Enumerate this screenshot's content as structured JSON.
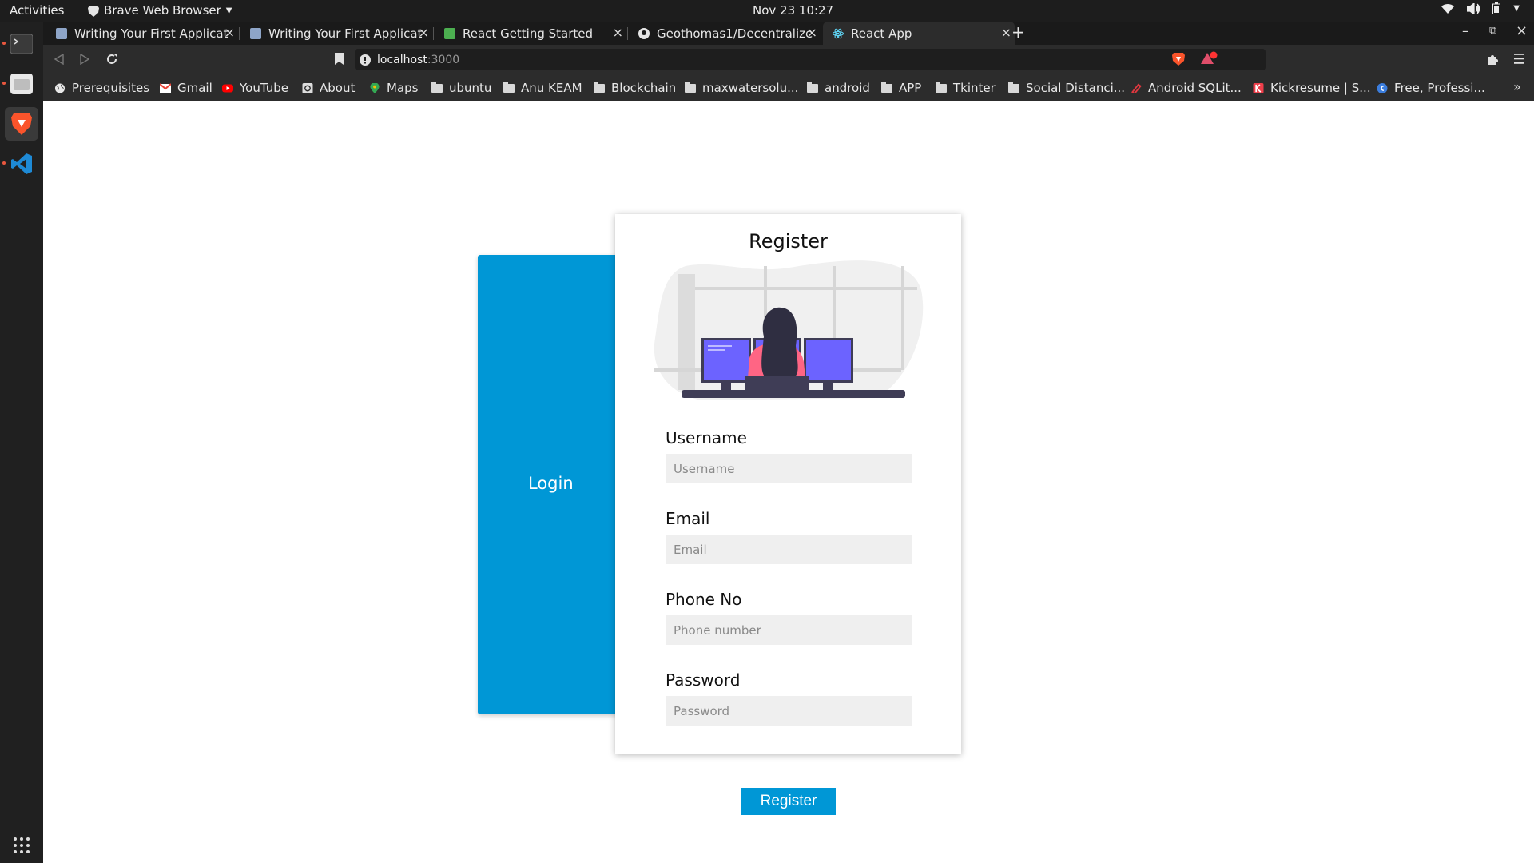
{
  "system": {
    "activities": "Activities",
    "app_name": "Brave Web Browser",
    "clock": "Nov 23  10:27"
  },
  "tabs": [
    {
      "title": "Writing Your First Applicat",
      "icon": "doc-icon"
    },
    {
      "title": "Writing Your First Applicat",
      "icon": "doc-icon"
    },
    {
      "title": "React Getting Started",
      "icon": "react-green-icon"
    },
    {
      "title": "Geothomas1/Decentralize",
      "icon": "github-icon"
    },
    {
      "title": "React App",
      "icon": "react-icon",
      "active": true
    }
  ],
  "address": {
    "host": "localhost",
    "port": ":3000"
  },
  "bookmarks": [
    {
      "label": "Prerequisites",
      "icon": "globe-icon"
    },
    {
      "label": "Gmail",
      "icon": "gmail-icon"
    },
    {
      "label": "YouTube",
      "icon": "youtube-icon"
    },
    {
      "label": "About",
      "icon": "about-icon"
    },
    {
      "label": "Maps",
      "icon": "maps-icon"
    },
    {
      "label": "ubuntu",
      "icon": "folder-icon"
    },
    {
      "label": "Anu KEAM",
      "icon": "folder-icon"
    },
    {
      "label": "Blockchain",
      "icon": "folder-icon"
    },
    {
      "label": "maxwatersolu...",
      "icon": "folder-icon"
    },
    {
      "label": "android",
      "icon": "folder-icon"
    },
    {
      "label": "APP",
      "icon": "folder-icon"
    },
    {
      "label": "Tkinter",
      "icon": "folder-icon"
    },
    {
      "label": "Social Distanci...",
      "icon": "folder-icon"
    },
    {
      "label": "Android SQLit...",
      "icon": "android-sqlite-icon"
    },
    {
      "label": "Kickresume | S...",
      "icon": "kickresume-icon"
    },
    {
      "label": "Free, Professi...",
      "icon": "free-icon"
    }
  ],
  "page": {
    "login_label": "Login",
    "register_title": "Register",
    "fields": [
      {
        "label": "Username",
        "placeholder": "Username"
      },
      {
        "label": "Email",
        "placeholder": "Email"
      },
      {
        "label": "Phone No",
        "placeholder": "Phone number"
      },
      {
        "label": "Password",
        "placeholder": "Password"
      }
    ],
    "register_button": "Register"
  },
  "colors": {
    "accent": "#0097d6",
    "monitor": "#6c63ff",
    "shirt": "#ff6584"
  }
}
